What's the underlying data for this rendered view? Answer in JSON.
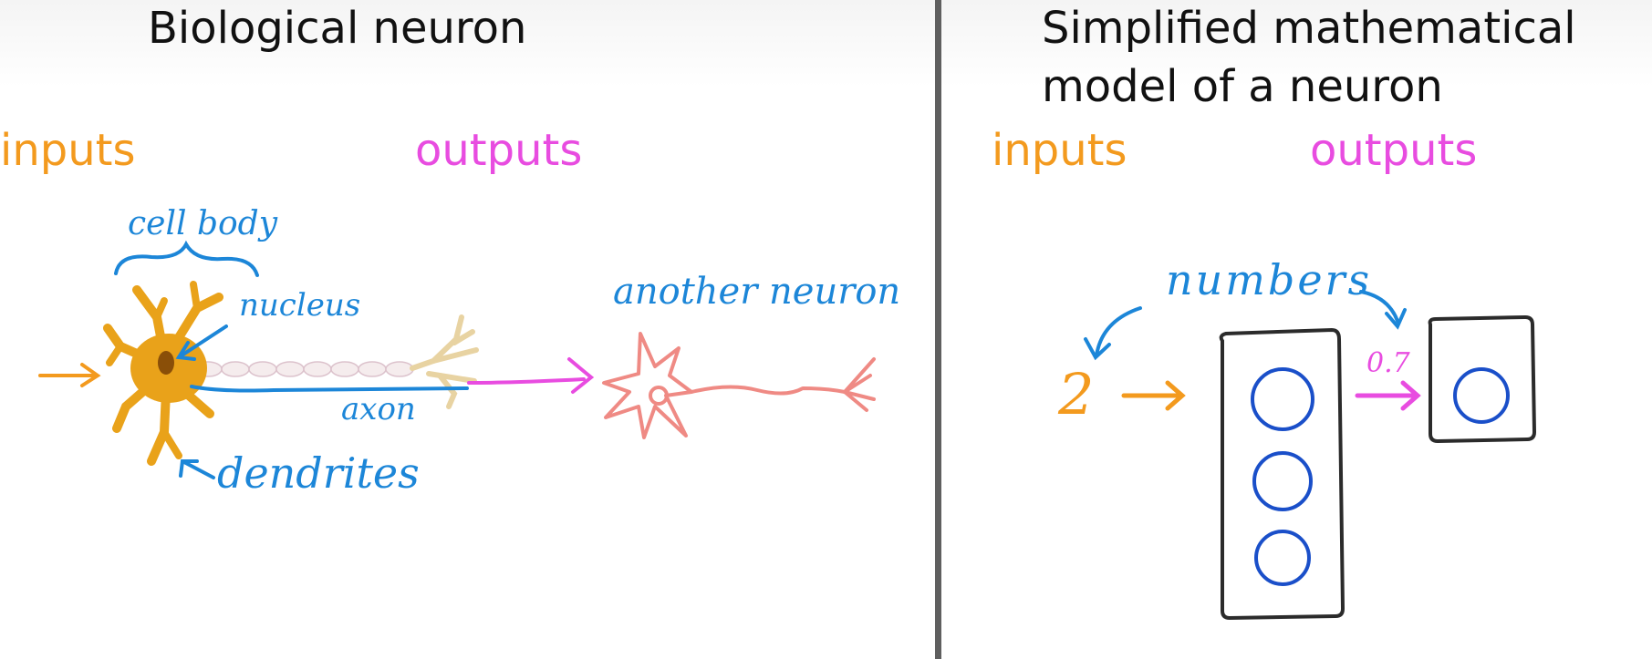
{
  "colors": {
    "inputs": "#f39a1e",
    "outputs": "#e84ce0",
    "annotation": "#1c86d8",
    "neuron_body": "#e9a21a",
    "another_neuron": "#ef8a84",
    "node_circle": "#1a4fc9",
    "box_stroke": "#2b2b2b",
    "divider": "#5f5f5f"
  },
  "left": {
    "title": "Biological neuron",
    "inputs_label": "inputs",
    "outputs_label": "outputs",
    "annotations": {
      "cell_body": "cell body",
      "nucleus": "nucleus",
      "axon": "axon",
      "dendrites": "dendrites",
      "another_neuron": "another neuron"
    }
  },
  "right": {
    "title_line1": "Simplified mathematical",
    "title_line2": "model of a neuron",
    "inputs_label": "inputs",
    "outputs_label": "outputs",
    "numbers_label": "numbers",
    "input_value": "2",
    "output_value": "0.7"
  }
}
